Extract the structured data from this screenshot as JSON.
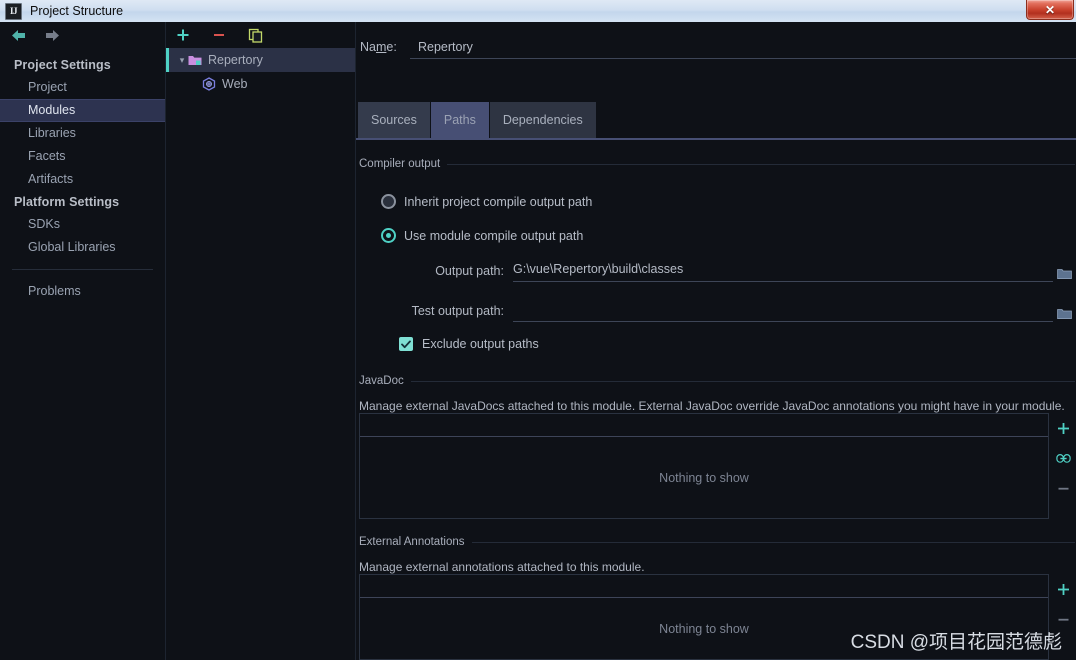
{
  "window": {
    "title": "Project Structure",
    "app_icon": "IJ",
    "close_label": "✕"
  },
  "sidebar": {
    "nav": {
      "back_icon": "arrow-left-icon",
      "forward_icon": "arrow-right-icon"
    },
    "groups": [
      {
        "heading": "Project Settings",
        "items": [
          {
            "label": "Project",
            "selected": false
          },
          {
            "label": "Modules",
            "selected": true
          },
          {
            "label": "Libraries",
            "selected": false
          },
          {
            "label": "Facets",
            "selected": false
          },
          {
            "label": "Artifacts",
            "selected": false
          }
        ]
      },
      {
        "heading": "Platform Settings",
        "items": [
          {
            "label": "SDKs",
            "selected": false
          },
          {
            "label": "Global Libraries",
            "selected": false
          }
        ]
      }
    ],
    "problems": {
      "label": "Problems"
    }
  },
  "tree": {
    "toolbar": [
      {
        "name": "add-module-button",
        "glyph": "+",
        "color": "#4fd1c5"
      },
      {
        "name": "remove-module-button",
        "glyph": "−",
        "color": "#d9534f"
      },
      {
        "name": "copy-module-button",
        "glyph": "copy-icon",
        "color": "#c3d96a"
      }
    ],
    "nodes": [
      {
        "label": "Repertory",
        "icon": "module-folder-icon",
        "selected": true,
        "expanded": true,
        "depth": 0
      },
      {
        "label": "Web",
        "icon": "web-facet-icon",
        "selected": false,
        "depth": 1
      }
    ]
  },
  "main": {
    "name_field": {
      "label_pre": "Na",
      "label_mnemonic": "m",
      "label_post": "e:",
      "value": "Repertory"
    },
    "tabs": [
      {
        "label": "Sources",
        "active": false
      },
      {
        "label": "Paths",
        "active": true
      },
      {
        "label": "Dependencies",
        "active": false
      }
    ],
    "compiler_output": {
      "group_label": "Compiler output",
      "radio_inherit": "Inherit project compile output path",
      "radio_module": "Use module compile output path",
      "radio_selected": "module",
      "output_path_label": "Output path:",
      "output_path_value": "G:\\vue\\Repertory\\build\\classes",
      "test_output_path_label": "Test output path:",
      "test_output_path_value": "",
      "exclude_label": "Exclude output paths",
      "exclude_checked": true,
      "browse_icon": "folder-browse-icon"
    },
    "javadoc": {
      "group_label": "JavaDoc",
      "description": "Manage external JavaDocs attached to this module. External JavaDoc override JavaDoc annotations you might have in your module.",
      "empty_text": "Nothing to show",
      "actions": [
        {
          "name": "add-javadoc-button",
          "glyph": "+",
          "color": "#4fd1c5"
        },
        {
          "name": "link-javadoc-button",
          "glyph": "link-icon",
          "color": "#4fd1c5"
        },
        {
          "name": "remove-javadoc-button",
          "glyph": "−",
          "color": "#6f7684"
        }
      ]
    },
    "annotations": {
      "group_label": "External Annotations",
      "description": "Manage external annotations attached to this module.",
      "empty_text": "Nothing to show",
      "actions": [
        {
          "name": "add-annotation-button",
          "glyph": "+",
          "color": "#4fd1c5"
        },
        {
          "name": "remove-annotation-button",
          "glyph": "−",
          "color": "#6f7684"
        }
      ]
    }
  },
  "watermark": {
    "text": "CSDN @项目花园范德彪"
  },
  "colors": {
    "accent_teal": "#4fd1c5",
    "selection_blue": "#2d3350",
    "tab_active": "#474f74",
    "background": "#0e1117",
    "remove_red": "#d9534f",
    "copy_green": "#c3d96a"
  }
}
